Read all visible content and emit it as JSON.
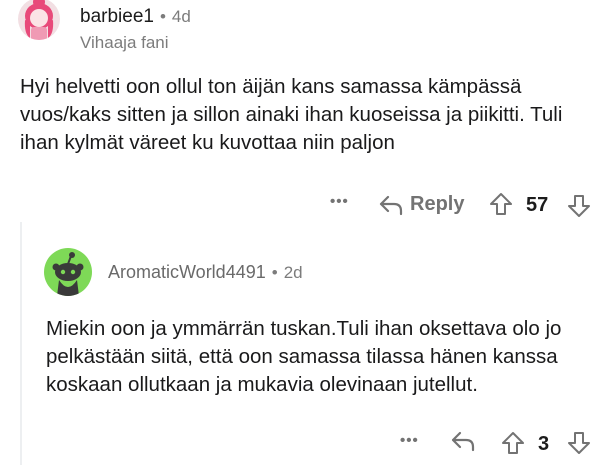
{
  "comment1": {
    "username": "barbiee1",
    "separator": "•",
    "time": "4d",
    "flair": "Vihaaja fani",
    "body": "Hyi helvetti oon ollul ton äijän kans samassa kämpässä vuos/kaks sitten ja sillon ainaki ihan kuoseissa ja piikitti. Tuli ihan kylmät väreet ku kuvottaa niin paljon",
    "more": "•••",
    "reply_label": "Reply",
    "score": "57"
  },
  "comment2": {
    "username": "AromaticWorld4491",
    "separator": "•",
    "time": "2d",
    "body": "Miekin oon ja ymmärrän tuskan.Tuli ihan oksettava olo jo pelkästään siitä, että oon samassa tilassa hänen kanssa koskaan ollutkaan ja mukavia olevinaan jutellut.",
    "more": "•••",
    "score": "3"
  },
  "colors": {
    "avatar1_bg": "#f2dfe3",
    "avatar1_hair": "#e84a7a",
    "avatar2_bg": "#7ed957",
    "snoo": "#3a3a3a",
    "icon_gray": "#737373"
  }
}
